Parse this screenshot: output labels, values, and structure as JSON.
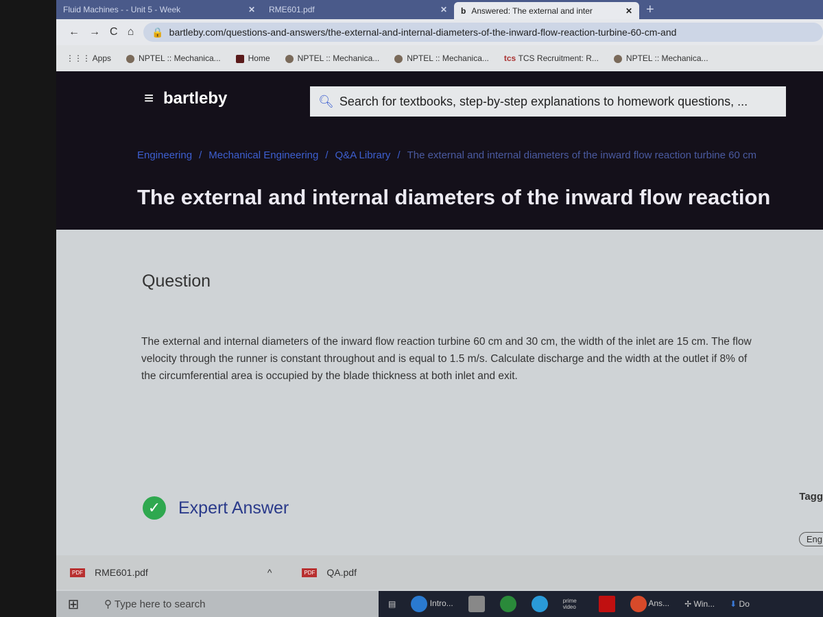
{
  "browser": {
    "tabs": [
      {
        "label": "Fluid Machines - - Unit 5 - Week"
      },
      {
        "label": "RME601.pdf"
      },
      {
        "label": "Answered: The external and inter"
      }
    ],
    "url": "bartleby.com/questions-and-answers/the-external-and-internal-diameters-of-the-inward-flow-reaction-turbine-60-cm-and",
    "bookmarks": [
      "Apps",
      "NPTEL :: Mechanica...",
      "Home",
      "NPTEL :: Mechanica...",
      "NPTEL :: Mechanica...",
      "TCS Recruitment: R...",
      "NPTEL :: Mechanica..."
    ]
  },
  "site": {
    "logo": "bartleby",
    "search_placeholder": "Search for textbooks, step-by-step explanations to homework questions, ...",
    "breadcrumb": [
      "Engineering",
      "Mechanical Engineering",
      "Q&A Library",
      "The external and internal diameters of the inward flow reaction turbine 60 cm"
    ],
    "title": "The external and internal diameters of the inward flow reaction",
    "question_heading": "Question",
    "question_text": "The external and internal diameters of the inward flow reaction turbine 60 cm and 30 cm, the width of the inlet are 15 cm. The flow velocity through the runner is constant throughout and is equal to 1.5 m/s. Calculate discharge and the width at the outlet if 8% of the circumferential area is occupied by the blade thickness at both inlet and exit.",
    "expert_answer": "Expert Answer",
    "tagged": "Tagg",
    "tag_chip": "Eng"
  },
  "downloads": [
    "RME601.pdf",
    "QA.pdf"
  ],
  "taskbar": {
    "search_placeholder": "Type here to search",
    "apps": [
      "Intro...",
      "prime video",
      "Ans...",
      "Win...",
      "Do"
    ]
  },
  "colors": {
    "accent": "#3d5fd0",
    "check": "#2fa84f",
    "header": "#14101a"
  }
}
